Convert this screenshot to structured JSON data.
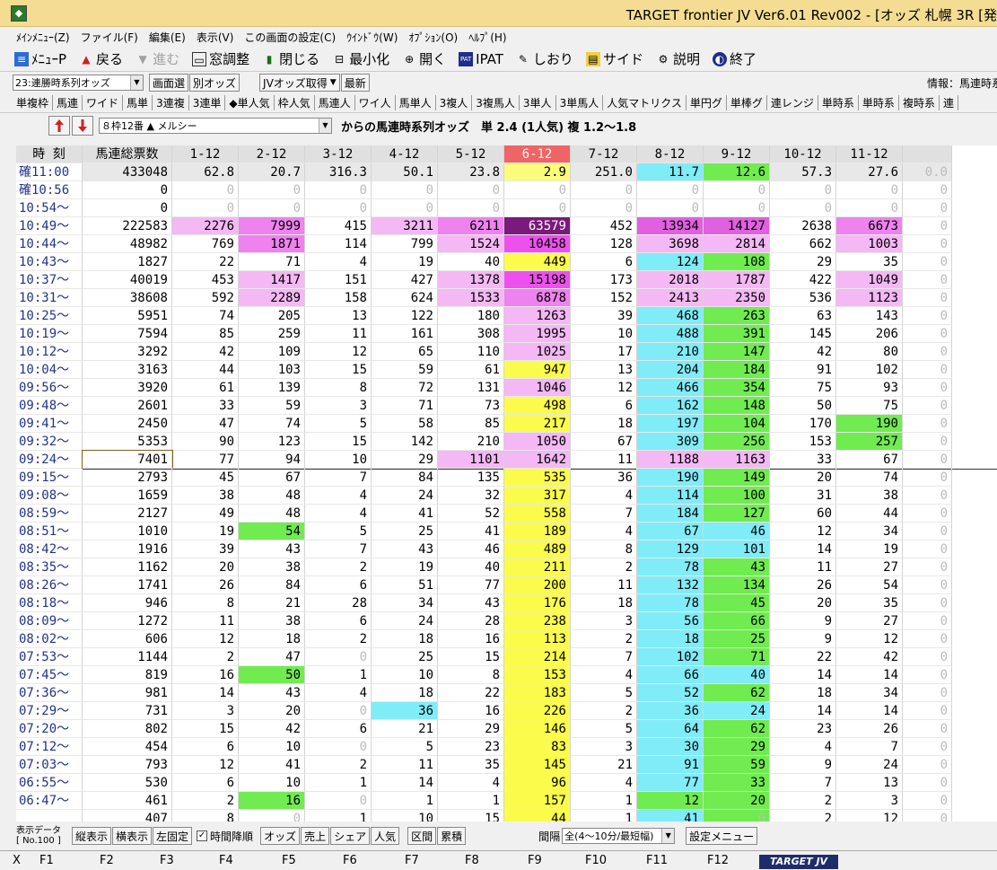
{
  "window": {
    "title": "TARGET frontier JV  Ver6.01  Rev002 - [オッズ 札幌 3R  [発"
  },
  "menu": [
    "ﾒｲﾝﾒﾆｭｰ(Z)",
    "ファイル(F)",
    "編集(E)",
    "表示(V)",
    "この画面の設定(C)",
    "ｳｲﾝﾄﾞｳ(W)",
    "ｵﾌﾟｼｮﾝ(O)",
    "ﾍﾙﾌﾟ(H)"
  ],
  "toolbar": {
    "menu_p": "ﾒﾆｭｰP",
    "back": "戻る",
    "forward": "進む",
    "window_adjust": "窓調整",
    "close": "閉じる",
    "minimize": "最小化",
    "open": "開く",
    "ipat": "IPAT",
    "bookmark": "しおり",
    "side": "サイド",
    "help": "説明",
    "exit": "終了"
  },
  "controls": {
    "view_select": "23:連勝時系列オッズ",
    "screen_select": "画面選",
    "other_odds": "別オッズ",
    "jv_fetch": "JVオッズ取得",
    "refresh": "最新",
    "info": "情報：馬連時系列オ"
  },
  "tabs": [
    "単複枠",
    "馬連",
    "ワイド",
    "馬単",
    "3連複",
    "3連単",
    "◆単人気",
    "枠人気",
    "馬連人",
    "ワイ人",
    "馬単人",
    "3複人",
    "3複馬人",
    "3単人",
    "3単馬人",
    "人気マトリクス",
    "単円グ",
    "単棒グ",
    "連レンジ",
    "単時系",
    "単時系",
    "複時系",
    "連"
  ],
  "horse": {
    "select": "８枠12番 ▲  メルシー",
    "header_text": "からの馬連時系列オッズ　単 2.4 (1人気)  複 1.2〜1.8"
  },
  "grid": {
    "headers": [
      "時 刻",
      "馬連総票数",
      "1-12",
      "2-12",
      "3-12",
      "4-12",
      "5-12",
      "6-12",
      "7-12",
      "8-12",
      "9-12",
      "10-12",
      "11-12",
      ""
    ],
    "rows": [
      {
        "time": "確11:00",
        "total": "433048",
        "v": [
          "62.8",
          "20.7",
          "316.3",
          "50.1",
          "23.8",
          "2.9",
          "251.0",
          "11.7",
          "12.6",
          "57.3",
          "27.6",
          "0.0"
        ]
      },
      {
        "time": "確10:56",
        "total": "0",
        "v": [
          "0",
          "0",
          "0",
          "0",
          "0",
          "0",
          "0",
          "0",
          "0",
          "0",
          "0",
          "0"
        ]
      },
      {
        "time": "10:54〜",
        "total": "0",
        "v": [
          "0",
          "0",
          "0",
          "0",
          "0",
          "0",
          "0",
          "0",
          "0",
          "0",
          "0",
          "0"
        ]
      },
      {
        "time": "10:49〜",
        "total": "222583",
        "v": [
          "2276",
          "7999",
          "415",
          "3211",
          "6211",
          "63579",
          "452",
          "13934",
          "14127",
          "2638",
          "6673",
          "0"
        ]
      },
      {
        "time": "10:44〜",
        "total": "48982",
        "v": [
          "769",
          "1871",
          "114",
          "799",
          "1524",
          "10458",
          "128",
          "3698",
          "2814",
          "662",
          "1003",
          "0"
        ]
      },
      {
        "time": "10:43〜",
        "total": "1827",
        "v": [
          "22",
          "71",
          "4",
          "19",
          "40",
          "449",
          "6",
          "124",
          "108",
          "29",
          "35",
          "0"
        ]
      },
      {
        "time": "10:37〜",
        "total": "40019",
        "v": [
          "453",
          "1417",
          "151",
          "427",
          "1378",
          "15198",
          "173",
          "2018",
          "1787",
          "422",
          "1049",
          "0"
        ]
      },
      {
        "time": "10:31〜",
        "total": "38608",
        "v": [
          "592",
          "2289",
          "158",
          "624",
          "1533",
          "6878",
          "152",
          "2413",
          "2350",
          "536",
          "1123",
          "0"
        ]
      },
      {
        "time": "10:25〜",
        "total": "5951",
        "v": [
          "74",
          "205",
          "13",
          "122",
          "180",
          "1263",
          "39",
          "468",
          "263",
          "63",
          "143",
          "0"
        ]
      },
      {
        "time": "10:19〜",
        "total": "7594",
        "v": [
          "85",
          "259",
          "11",
          "161",
          "308",
          "1995",
          "10",
          "488",
          "391",
          "145",
          "206",
          "0"
        ]
      },
      {
        "time": "10:12〜",
        "total": "3292",
        "v": [
          "42",
          "109",
          "12",
          "65",
          "110",
          "1025",
          "17",
          "210",
          "147",
          "42",
          "80",
          "0"
        ]
      },
      {
        "time": "10:04〜",
        "total": "3163",
        "v": [
          "44",
          "103",
          "15",
          "59",
          "61",
          "947",
          "13",
          "204",
          "184",
          "91",
          "102",
          "0"
        ]
      },
      {
        "time": "09:56〜",
        "total": "3920",
        "v": [
          "61",
          "139",
          "8",
          "72",
          "131",
          "1046",
          "12",
          "466",
          "354",
          "75",
          "93",
          "0"
        ]
      },
      {
        "time": "09:48〜",
        "total": "2601",
        "v": [
          "33",
          "59",
          "3",
          "71",
          "73",
          "498",
          "6",
          "162",
          "148",
          "50",
          "75",
          "0"
        ]
      },
      {
        "time": "09:41〜",
        "total": "2450",
        "v": [
          "47",
          "74",
          "5",
          "58",
          "85",
          "217",
          "18",
          "197",
          "104",
          "170",
          "190",
          "0"
        ]
      },
      {
        "time": "09:32〜",
        "total": "5353",
        "v": [
          "90",
          "123",
          "15",
          "142",
          "210",
          "1050",
          "67",
          "309",
          "256",
          "153",
          "257",
          "0"
        ]
      },
      {
        "time": "09:24〜",
        "total": "7401",
        "v": [
          "77",
          "94",
          "10",
          "29",
          "1101",
          "1642",
          "11",
          "1188",
          "1163",
          "33",
          "67",
          "0"
        ]
      },
      {
        "time": "09:15〜",
        "total": "2793",
        "v": [
          "45",
          "67",
          "7",
          "84",
          "135",
          "535",
          "36",
          "190",
          "149",
          "20",
          "74",
          "0"
        ]
      },
      {
        "time": "09:08〜",
        "total": "1659",
        "v": [
          "38",
          "48",
          "4",
          "24",
          "32",
          "317",
          "4",
          "114",
          "100",
          "31",
          "38",
          "0"
        ]
      },
      {
        "time": "08:59〜",
        "total": "2127",
        "v": [
          "49",
          "48",
          "4",
          "41",
          "52",
          "558",
          "7",
          "184",
          "127",
          "60",
          "44",
          "0"
        ]
      },
      {
        "time": "08:51〜",
        "total": "1010",
        "v": [
          "19",
          "54",
          "5",
          "25",
          "41",
          "189",
          "4",
          "67",
          "46",
          "12",
          "34",
          "0"
        ]
      },
      {
        "time": "08:42〜",
        "total": "1916",
        "v": [
          "39",
          "43",
          "7",
          "43",
          "46",
          "489",
          "8",
          "129",
          "101",
          "14",
          "19",
          "0"
        ]
      },
      {
        "time": "08:35〜",
        "total": "1162",
        "v": [
          "20",
          "38",
          "2",
          "19",
          "40",
          "211",
          "2",
          "78",
          "43",
          "11",
          "27",
          "0"
        ]
      },
      {
        "time": "08:26〜",
        "total": "1741",
        "v": [
          "26",
          "84",
          "6",
          "51",
          "77",
          "200",
          "11",
          "132",
          "134",
          "26",
          "54",
          "0"
        ]
      },
      {
        "time": "08:18〜",
        "total": "946",
        "v": [
          "8",
          "21",
          "28",
          "34",
          "43",
          "176",
          "18",
          "78",
          "45",
          "20",
          "35",
          "0"
        ]
      },
      {
        "time": "08:09〜",
        "total": "1272",
        "v": [
          "11",
          "38",
          "6",
          "24",
          "28",
          "238",
          "3",
          "56",
          "66",
          "9",
          "27",
          "0"
        ]
      },
      {
        "time": "08:02〜",
        "total": "606",
        "v": [
          "12",
          "18",
          "2",
          "18",
          "16",
          "113",
          "2",
          "18",
          "25",
          "9",
          "12",
          "0"
        ]
      },
      {
        "time": "07:53〜",
        "total": "1144",
        "v": [
          "2",
          "47",
          "0",
          "25",
          "15",
          "214",
          "7",
          "102",
          "71",
          "22",
          "42",
          "0"
        ]
      },
      {
        "time": "07:45〜",
        "total": "819",
        "v": [
          "16",
          "50",
          "1",
          "10",
          "8",
          "153",
          "4",
          "66",
          "40",
          "14",
          "14",
          "0"
        ]
      },
      {
        "time": "07:36〜",
        "total": "981",
        "v": [
          "14",
          "43",
          "4",
          "18",
          "22",
          "183",
          "5",
          "52",
          "62",
          "18",
          "34",
          "0"
        ]
      },
      {
        "time": "07:29〜",
        "total": "731",
        "v": [
          "3",
          "20",
          "0",
          "36",
          "16",
          "226",
          "2",
          "36",
          "24",
          "14",
          "14",
          "0"
        ]
      },
      {
        "time": "07:20〜",
        "total": "802",
        "v": [
          "15",
          "42",
          "6",
          "21",
          "29",
          "146",
          "5",
          "64",
          "62",
          "23",
          "26",
          "0"
        ]
      },
      {
        "time": "07:12〜",
        "total": "454",
        "v": [
          "6",
          "10",
          "0",
          "5",
          "23",
          "83",
          "3",
          "30",
          "29",
          "4",
          "7",
          "0"
        ]
      },
      {
        "time": "07:03〜",
        "total": "793",
        "v": [
          "12",
          "41",
          "2",
          "11",
          "35",
          "145",
          "21",
          "91",
          "59",
          "9",
          "24",
          "0"
        ]
      },
      {
        "time": "06:55〜",
        "total": "530",
        "v": [
          "6",
          "10",
          "1",
          "14",
          "4",
          "96",
          "4",
          "77",
          "33",
          "7",
          "13",
          "0"
        ]
      },
      {
        "time": "06:47〜",
        "total": "461",
        "v": [
          "2",
          "16",
          "0",
          "1",
          "1",
          "157",
          "1",
          "12",
          "20",
          "2",
          "3",
          "0"
        ]
      },
      {
        "time": "",
        "total": "407",
        "v": [
          "8",
          "0",
          "1",
          "10",
          "15",
          "44",
          "1",
          "41",
          "0",
          "2",
          "12",
          "0"
        ]
      }
    ]
  },
  "bottom": {
    "label_line1": "表示データ",
    "label_line2": "[ No.100 ]",
    "vertical": "縦表示",
    "horizontal": "横表示",
    "left_fixed": "左固定",
    "time_desc": "時間降順",
    "odds": "オッズ",
    "sales": "売上",
    "share": "シェア",
    "popularity": "人気",
    "interval": "区間",
    "cumulative": "累積",
    "spacing_label": "間隔",
    "spacing_select": "全(4〜10分/最短幅)",
    "settings_menu": "設定メニュー"
  },
  "fkeys": [
    "X",
    "F1",
    "F2",
    "F3",
    "F4",
    "F5",
    "F6",
    "F7",
    "F8",
    "F9",
    "F10",
    "F11",
    "F12"
  ],
  "logo": "TARGET JV"
}
